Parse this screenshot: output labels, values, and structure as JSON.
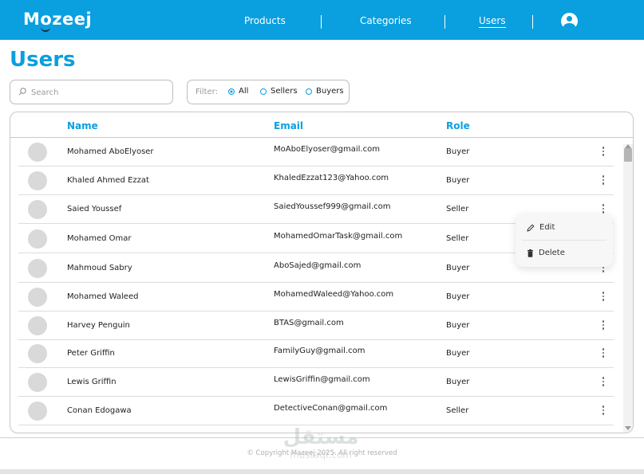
{
  "app": {
    "logo_text": "Mozeej",
    "accent_color": "#0a9fdf"
  },
  "nav": {
    "items": [
      {
        "label": "Products",
        "active": false
      },
      {
        "label": "Categories",
        "active": false
      },
      {
        "label": "Users",
        "active": true
      }
    ],
    "profile_icon": "user-circle-icon"
  },
  "page": {
    "title": "Users"
  },
  "search": {
    "placeholder": "Search",
    "value": "",
    "icon": "search-icon"
  },
  "filter": {
    "label": "Filter:",
    "options": [
      {
        "label": "All",
        "checked": true
      },
      {
        "label": "Sellers",
        "checked": false
      },
      {
        "label": "Buyers",
        "checked": false
      }
    ]
  },
  "table": {
    "columns": [
      "Name",
      "Email",
      "Role"
    ],
    "rows": [
      {
        "name": "Mohamed AboElyoser",
        "email": "MoAboElyoser@gmail.com",
        "role": "Buyer"
      },
      {
        "name": "Khaled Ahmed Ezzat",
        "email": "KhaledEzzat123@Yahoo.com",
        "role": "Buyer"
      },
      {
        "name": "Saied Youssef",
        "email": "SaiedYoussef999@gmail.com",
        "role": "Seller"
      },
      {
        "name": "Mohamed Omar",
        "email": "MohamedOmarTask@gmail.com",
        "role": "Seller"
      },
      {
        "name": "Mahmoud Sabry",
        "email": "AboSajed@gmail.com",
        "role": "Buyer"
      },
      {
        "name": "Mohamed Waleed",
        "email": "MohamedWaleed@Yahoo.com",
        "role": "Buyer"
      },
      {
        "name": "Harvey Penguin",
        "email": "BTAS@gmail.com",
        "role": "Buyer"
      },
      {
        "name": "Peter Griffin",
        "email": "FamilyGuy@gmail.com",
        "role": "Buyer"
      },
      {
        "name": "Lewis Griffin",
        "email": "LewisGriffin@gmail.com",
        "role": "Buyer"
      },
      {
        "name": "Conan Edogawa",
        "email": "DetectiveConan@gmail.com",
        "role": "Seller"
      }
    ]
  },
  "context_menu": {
    "items": [
      {
        "label": "Edit",
        "icon": "pencil-icon"
      },
      {
        "label": "Delete",
        "icon": "trash-icon"
      }
    ]
  },
  "footer": {
    "copyright": "© Copyright Mazeej 2025. All right reserved",
    "watermark_arabic": "مستقل",
    "watermark_latin": "mostaql.com"
  }
}
